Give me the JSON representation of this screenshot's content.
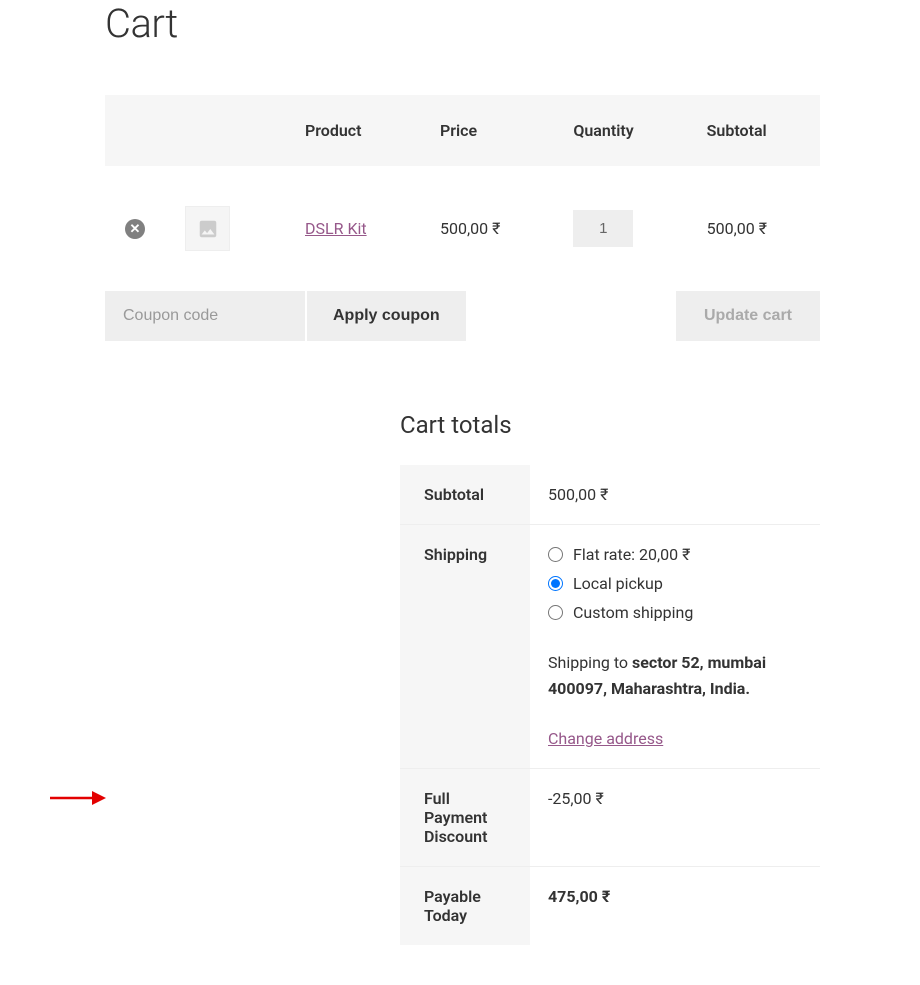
{
  "page": {
    "title": "Cart"
  },
  "table": {
    "headers": {
      "product": "Product",
      "price": "Price",
      "quantity": "Quantity",
      "subtotal": "Subtotal"
    },
    "item": {
      "name": "DSLR Kit",
      "price": "500,00 ₹",
      "quantity": "1",
      "subtotal": "500,00 ₹"
    }
  },
  "actions": {
    "coupon_placeholder": "Coupon code",
    "apply_coupon": "Apply coupon",
    "update_cart": "Update cart"
  },
  "totals": {
    "title": "Cart totals",
    "subtotal_label": "Subtotal",
    "subtotal_value": "500,00 ₹",
    "shipping_label": "Shipping",
    "shipping_options": {
      "flat_rate_label": "Flat rate: ",
      "flat_rate_price": "20,00 ₹",
      "local_pickup": "Local pickup",
      "custom_shipping": "Custom shipping"
    },
    "shipping_to_prefix": "Shipping to ",
    "shipping_address": "sector 52, mumbai 400097, Maharashtra, India",
    "change_address": "Change address",
    "discount_label": "Full Payment Discount",
    "discount_value": "-25,00 ₹",
    "payable_label": "Payable Today",
    "payable_value": "475,00 ₹"
  }
}
